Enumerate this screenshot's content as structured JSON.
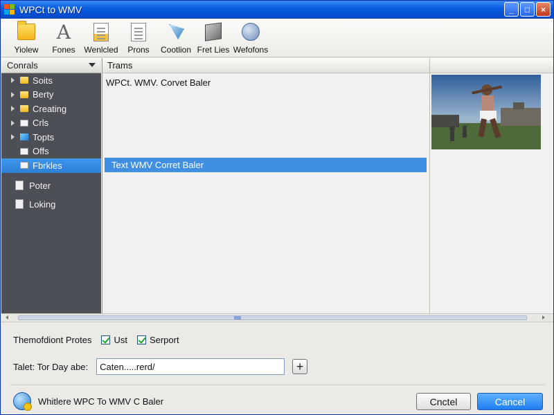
{
  "window": {
    "title": "WPCt to WMV",
    "controls": [
      "_",
      "□",
      "×"
    ]
  },
  "toolbar": {
    "items": [
      {
        "label": "Yiolew",
        "icon": "folder-icon"
      },
      {
        "label": "Fones",
        "icon": "font-icon"
      },
      {
        "label": "Wenlcled",
        "icon": "document-icon"
      },
      {
        "label": "Prons",
        "icon": "page-icon"
      },
      {
        "label": "Cootlion",
        "icon": "flag-icon"
      },
      {
        "label": "Fret Lies",
        "icon": "cube-icon"
      },
      {
        "label": "Wefofons",
        "icon": "globe-icon"
      }
    ]
  },
  "sidebar": {
    "header": "Conrals",
    "items": [
      {
        "label": "Soits",
        "icon": "folder"
      },
      {
        "label": "Berty",
        "icon": "folder"
      },
      {
        "label": "Creating",
        "icon": "folder"
      },
      {
        "label": "Crls",
        "icon": "page"
      },
      {
        "label": "Topts",
        "icon": "blue"
      },
      {
        "label": "Offs",
        "icon": "page"
      },
      {
        "label": "Fbrkles",
        "icon": "page"
      }
    ],
    "selected_index": 6,
    "links": [
      {
        "label": "Poter"
      },
      {
        "label": "Loking"
      }
    ]
  },
  "main": {
    "column_header": "Trams",
    "rows": [
      "WPCt. WMV. Corvet Baler"
    ],
    "selected_row": "Text WMV Corret Baler"
  },
  "options": {
    "label": "Themofdiont Protes",
    "checkboxes": [
      {
        "label": "Ust",
        "checked": true
      },
      {
        "label": "Serport",
        "checked": true
      }
    ]
  },
  "field": {
    "label": "Talet:  Tor Day abe:",
    "value": "Caten.....rerd/"
  },
  "status": {
    "text": "Whitlere WPC To WMV C Baler"
  },
  "buttons": {
    "secondary": "Cnctel",
    "primary": "Cancel"
  }
}
